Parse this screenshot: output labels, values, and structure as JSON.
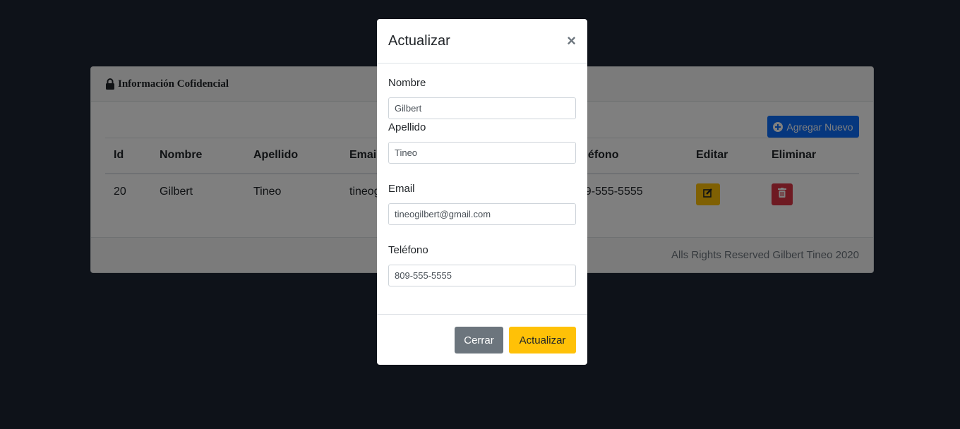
{
  "card": {
    "header_title": "Información Cofidencial",
    "add_button": "Agregar Nuevo",
    "columns": [
      "Id",
      "Nombre",
      "Apellido",
      "Email",
      "Teléfono",
      "Editar",
      "Eliminar"
    ],
    "rows": [
      {
        "id": "20",
        "nombre": "Gilbert",
        "apellido": "Tineo",
        "email": "tineogilbert@gmail.com",
        "telefono": "809-555-5555"
      }
    ],
    "footer": "Alls Rights Reserved Gilbert Tineo 2020"
  },
  "modal": {
    "title": "Actualizar",
    "close_glyph": "×",
    "fields": {
      "nombre": {
        "label": "Nombre",
        "value": "Gilbert"
      },
      "apellido": {
        "label": "Apellido",
        "value": "Tineo"
      },
      "email": {
        "label": "Email",
        "value": "tineogilbert@gmail.com"
      },
      "telefono": {
        "label": "Teléfono",
        "value": "809-555-5555"
      }
    },
    "cancel_button": "Cerrar",
    "submit_button": "Actualizar"
  },
  "colors": {
    "background": "#1d2532",
    "primary": "#0d6efd",
    "warning": "#ffc107",
    "danger": "#dc3545",
    "secondary": "#6c757d"
  },
  "icons": [
    "lock-icon",
    "plus-circle-icon",
    "edit-icon",
    "trash-icon",
    "close-icon"
  ]
}
